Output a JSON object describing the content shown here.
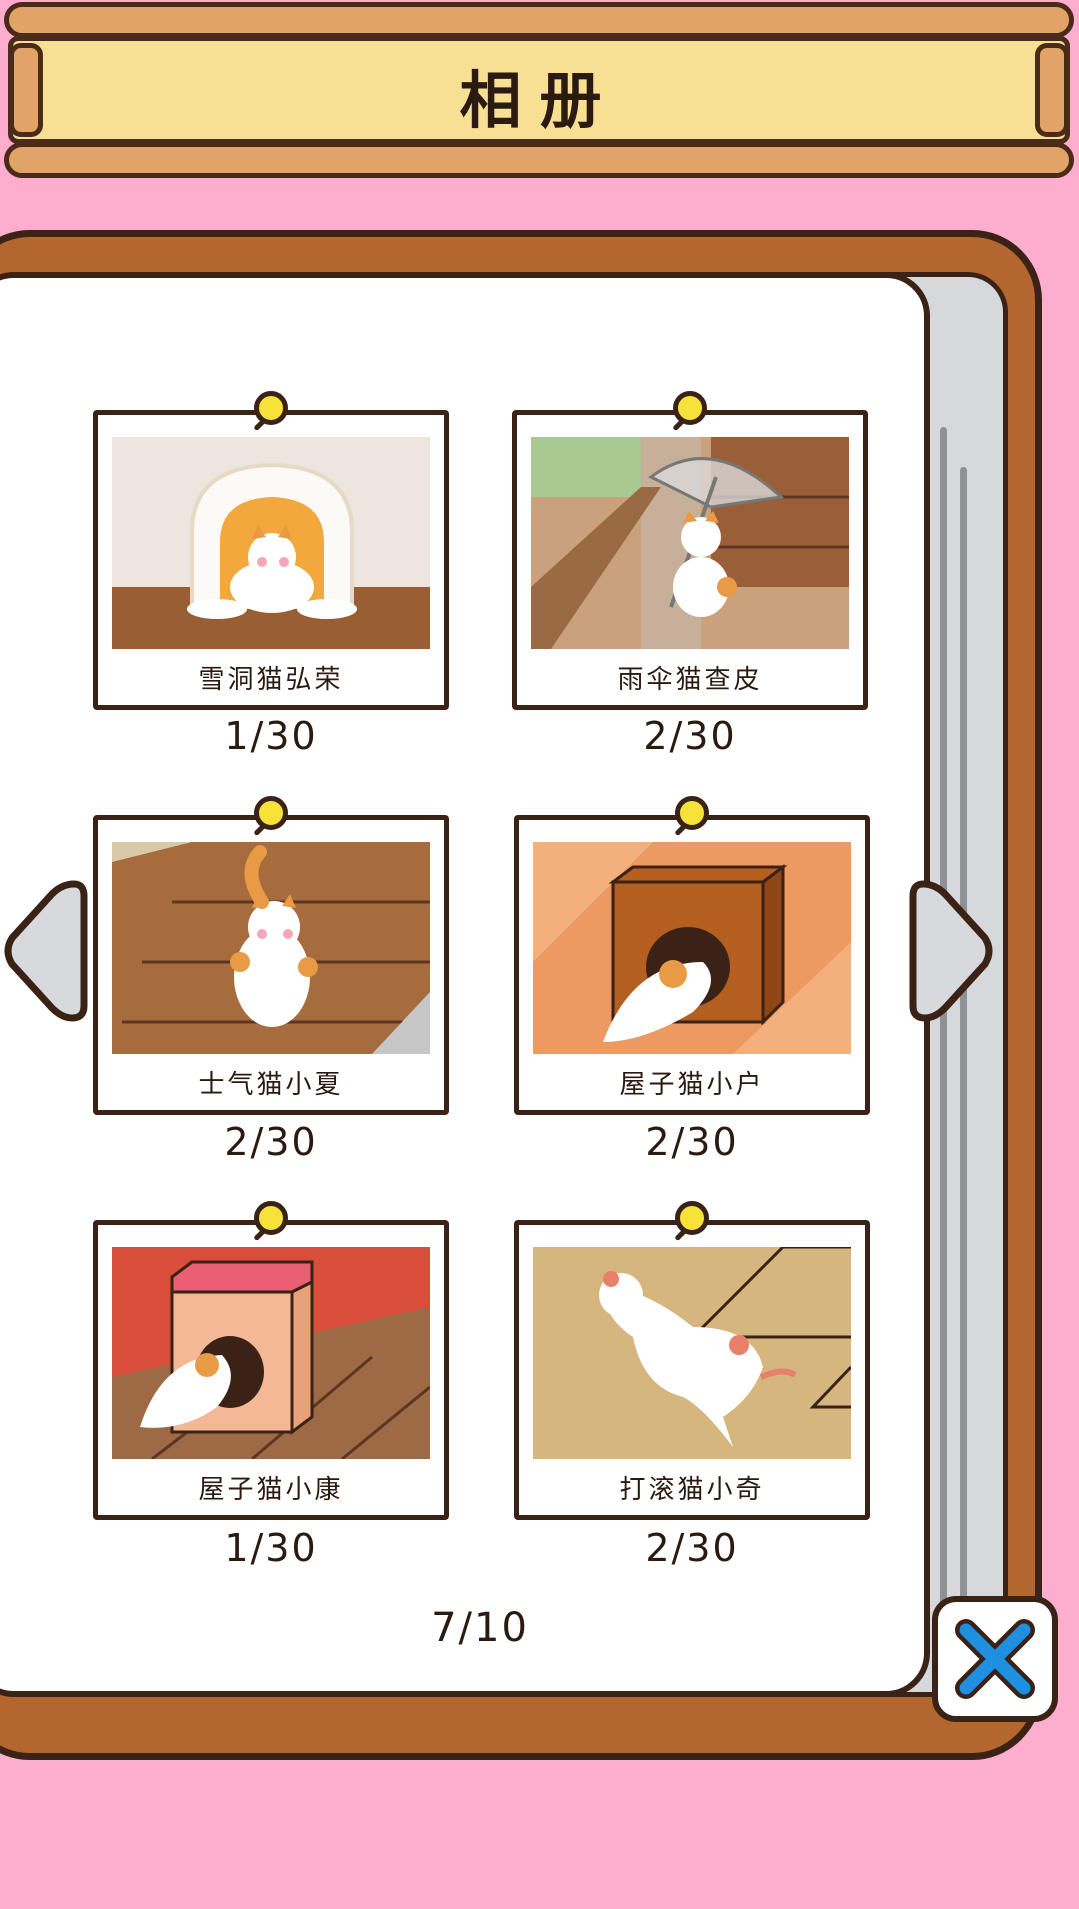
{
  "header": {
    "title": "相册"
  },
  "album": {
    "cards": [
      {
        "name": "雪洞猫弘荣",
        "count": "1/30",
        "scene": "snow-cave"
      },
      {
        "name": "雨伞猫查皮",
        "count": "2/30",
        "scene": "umbrella"
      },
      {
        "name": "士气猫小夏",
        "count": "2/30",
        "scene": "floor-standing"
      },
      {
        "name": "屋子猫小户",
        "count": "2/30",
        "scene": "wooden-box"
      },
      {
        "name": "屋子猫小康",
        "count": "1/30",
        "scene": "pink-box"
      },
      {
        "name": "打滚猫小奇",
        "count": "2/30",
        "scene": "rolling"
      }
    ],
    "pager": "7/10"
  },
  "icons": {
    "prev": "chevron-left-icon",
    "next": "chevron-right-icon",
    "close": "close-icon"
  },
  "colors": {
    "background": "#fdaecf",
    "frame": "#b3662d",
    "plaque": "#f7df94",
    "pin": "#f7e23a",
    "close_x": "#1f8fe0"
  }
}
